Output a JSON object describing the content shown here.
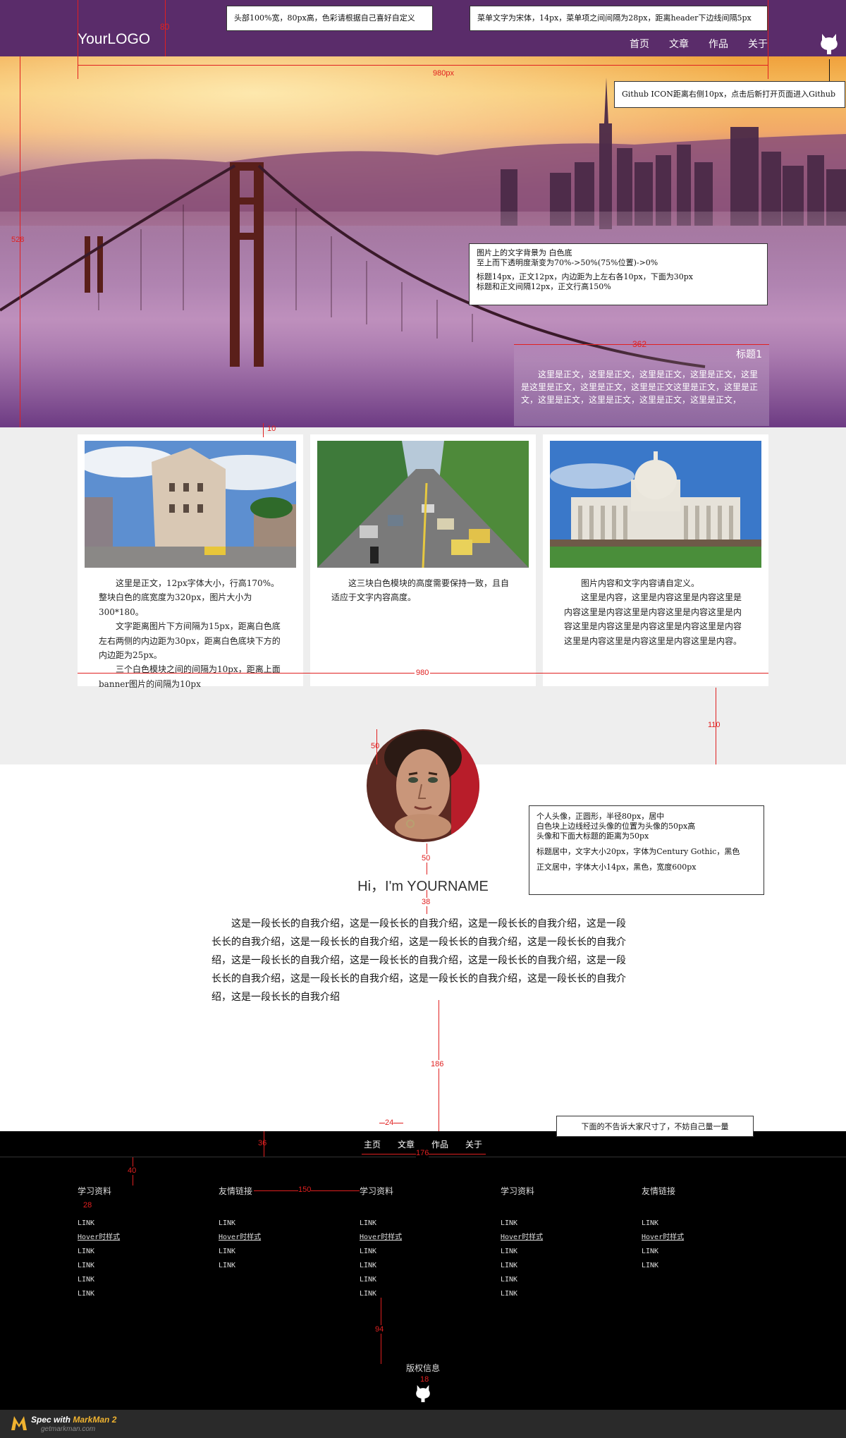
{
  "header": {
    "logo": "YourLOGO",
    "nav": [
      "首页",
      "文章",
      "作品",
      "关于"
    ]
  },
  "banner": {
    "caption_title": "标题1",
    "caption_text": "这里是正文，这里是正文，这里是正文，这里是正文，这里是这里是正文，这里是正文，这里是正文这里是正文，这里是正文，这里是正文，这里是正文，这里是正文，这里是正文，"
  },
  "cards": [
    {
      "paragraphs": [
        "这里是正文，12px字体大小，行高170%。整块白色的底宽度为320px，图片大小为300*180。",
        "文字距离图片下方间隔为15px，距离白色底左右两侧的内边距为30px，距离白色底块下方的内边距为25px。",
        "三个白色模块之间的间隔为10px，距离上面banner图片的间隔为10px"
      ]
    },
    {
      "paragraphs": [
        "这三块白色模块的高度需要保持一致，且自适应于文字内容高度。"
      ]
    },
    {
      "paragraphs": [
        "图片内容和文字内容请自定义。",
        "这里是内容，这里是内容这里是内容这里是内容这里是内容这里是内容这里是内容这里是内容这里是内容这里是内容这里是内容这里是内容这里是内容这里是内容这里是内容这里是内容。"
      ]
    }
  ],
  "profile": {
    "greeting": "Hi，I'm YOURNAME",
    "intro": "这是一段长长的自我介绍，这是一段长长的自我介绍，这是一段长长的自我介绍，这是一段长长的自我介绍，这是一段长长的自我介绍，这是一段长长的自我介绍，这是一段长长的自我介绍，这是一段长长的自我介绍，这是一段长长的自我介绍，这是一段长长的自我介绍，这是一段长长的自我介绍，这是一段长长的自我介绍，这是一段长长的自我介绍，这是一段长长的自我介绍，这是一段长长的自我介绍"
  },
  "footer": {
    "nav": [
      "主页",
      "文章",
      "作品",
      "关于"
    ],
    "columns": [
      {
        "title": "学习资料",
        "links": [
          "LINK",
          "Hover时样式",
          "LINK",
          "LINK",
          "LINK",
          "LINK"
        ]
      },
      {
        "title": "友情链接",
        "links": [
          "LINK",
          "Hover时样式",
          "LINK",
          "LINK"
        ]
      },
      {
        "title": "学习资料",
        "links": [
          "LINK",
          "Hover时样式",
          "LINK",
          "LINK",
          "LINK",
          "LINK"
        ]
      },
      {
        "title": "学习资料",
        "links": [
          "LINK",
          "Hover时样式",
          "LINK",
          "LINK",
          "LINK",
          "LINK"
        ]
      },
      {
        "title": "友情链接",
        "links": [
          "LINK",
          "Hover时样式",
          "LINK",
          "LINK"
        ]
      }
    ],
    "copyright": "版权信息"
  },
  "annotations": {
    "header_note": "头部100%宽，80px高，色彩请根据自己喜好自定义",
    "menu_note": "菜单文字为宋体，14px，菜单项之间间隔为28px，距离header下边线间隔5px",
    "github_note": "Github ICON距离右侧10px，点击后新打开页面进入Github",
    "caption_note": [
      "图片上的文字背景为 白色底",
      "至上而下透明度渐变为70%->50%(75%位置)->0%",
      "",
      "标题14px，正文12px，内边距为上左右各10px，下面为30px",
      "标题和正文间隔12px，正文行高150%"
    ],
    "avatar_note": [
      "个人头像，正圆形，半径80px，居中",
      "白色块上边线经过头像的位置为头像的50px高",
      "头像和下面大标题的距离为50px",
      "",
      "标题居中，文字大小20px，字体为Century Gothic，黑色",
      "",
      "正文居中，字体大小14px，黑色，宽度600px"
    ],
    "footer_note": "下面的不告诉大家尺寸了，不妨自己量一量",
    "dims": {
      "logo_h": "80",
      "width_980": "980px",
      "banner_h": "528",
      "caption_w": "362",
      "gap_10": "10",
      "cards_w": "980",
      "gap_110": "110",
      "avatar_50": "50",
      "hi_50": "50",
      "hi_38": "38",
      "gap_186": "186",
      "gap_24": "24",
      "foot_36": "36",
      "foot_176": "176",
      "foot_40": "40",
      "foot_28": "28",
      "foot_150": "150",
      "foot_94": "94",
      "foot_18": "18"
    }
  },
  "markman": {
    "label_prefix": "Spec with ",
    "label_brand": "MarkMan 2",
    "sub": "getmarkman.com"
  }
}
